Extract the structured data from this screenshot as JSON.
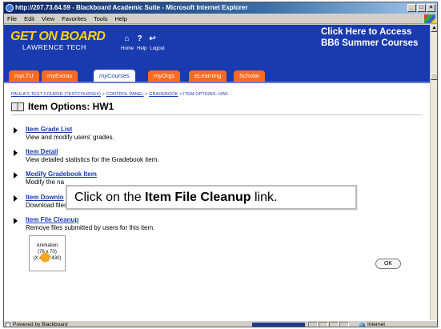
{
  "window": {
    "title": "http://207.73.64.59 - Blackboard Academic Suite - Microsoft Internet Explorer",
    "buttons": [
      "_",
      "□",
      "×"
    ]
  },
  "menu": [
    "File",
    "Edit",
    "View",
    "Favorites",
    "Tools",
    "Help"
  ],
  "header": {
    "logo_main": "GET ON BOARD",
    "logo_sub": "LAWRENCE TECH",
    "icons": [
      "home-icon",
      "help-icon",
      "logout-icon"
    ],
    "icon_labels": [
      "Home",
      "Help",
      "Logout"
    ],
    "promo_line1": "Click Here to Access",
    "promo_line2": "BB6 Summer Courses",
    "brand_color": "#1a3bb0",
    "tab_color": "#ff6a1f"
  },
  "tabs": [
    "myLTU",
    "myExtras",
    "myCourses",
    "myOrgs",
    "eLearning",
    "Scholar"
  ],
  "active_tab": "myCourses",
  "breadcrumb": {
    "items": [
      "PAULA'S TEST COURSE (TESTCOURSE6)",
      "CONTROL PANEL",
      "GRADEBOOK"
    ],
    "separator": ">",
    "current": "ITEM OPTIONS: HW1"
  },
  "page_title": "Item Options: HW1",
  "options": [
    {
      "link": "Item Grade List",
      "desc": "View and modify users' grades."
    },
    {
      "link": "Item Detail",
      "desc": "View detailed statistics for the Gradebook item."
    },
    {
      "link": "Modify Gradebook Item",
      "desc": "Modify the na"
    },
    {
      "link": "Item Downlo",
      "desc": "Download files submitted by users for this item."
    },
    {
      "link": "Item File Cleanup",
      "desc": "Remove files submitted by users for this item."
    }
  ],
  "callout": {
    "prefix": "Click on the ",
    "bold": "Item File Cleanup",
    "suffix": " link."
  },
  "animation": {
    "title": "Animation",
    "size": "(76 x 70)",
    "coords": "(X:47, Y:430)"
  },
  "ok_label": "OK",
  "status": {
    "text": "Powered by Blackboard",
    "zone": "Internet"
  }
}
